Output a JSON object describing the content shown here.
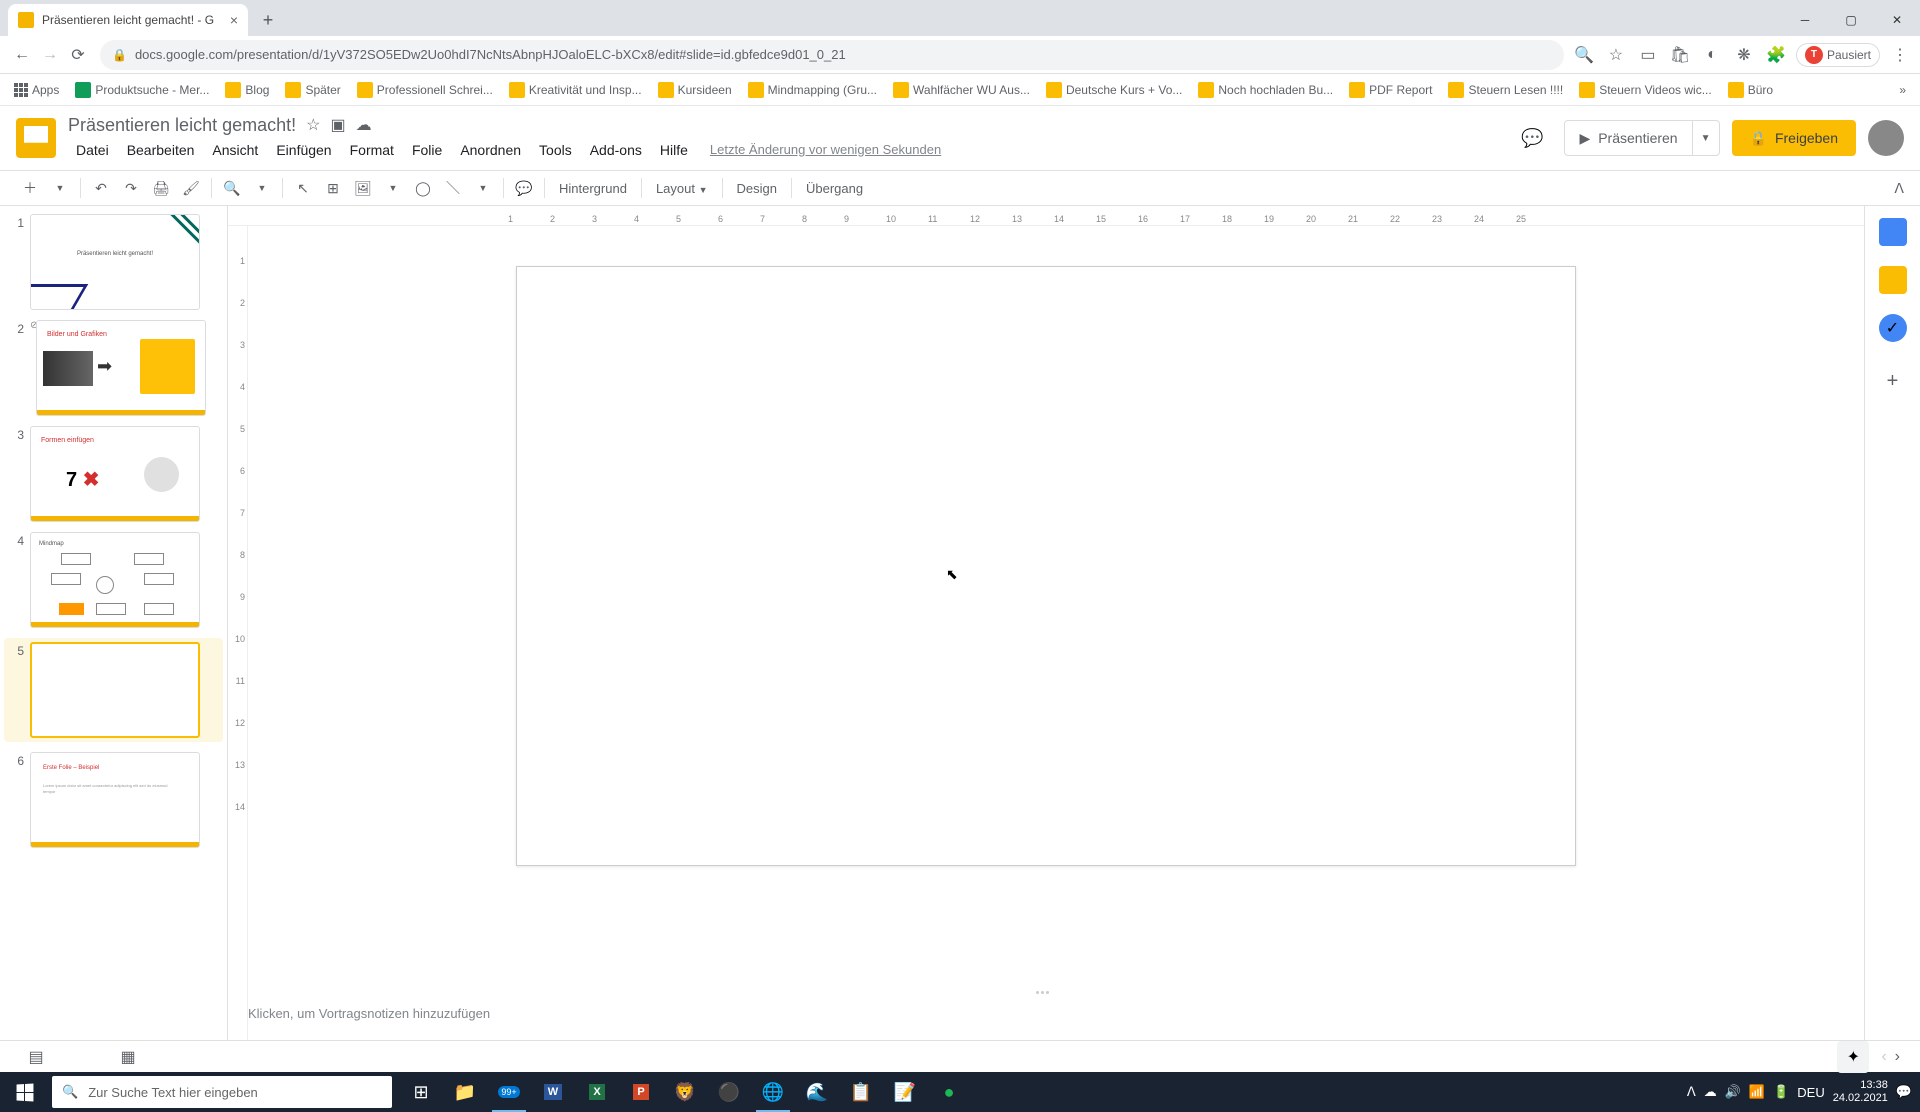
{
  "browser": {
    "tab_title": "Präsentieren leicht gemacht! - G",
    "url": "docs.google.com/presentation/d/1yV372SO5EDw2Uo0hdI7NcNtsAbnpHJOaloELC-bXCx8/edit#slide=id.gbfedce9d01_0_21",
    "pause_label": "Pausiert",
    "pause_letter": "T"
  },
  "bookmarks": {
    "apps": "Apps",
    "items": [
      "Produktsuche - Mer...",
      "Blog",
      "Später",
      "Professionell Schrei...",
      "Kreativität und Insp...",
      "Kursideen",
      "Mindmapping  (Gru...",
      "Wahlfächer WU Aus...",
      "Deutsche Kurs + Vo...",
      "Noch hochladen Bu...",
      "PDF Report",
      "Steuern Lesen !!!!",
      "Steuern Videos wic...",
      "Büro"
    ]
  },
  "doc": {
    "title": "Präsentieren leicht gemacht!",
    "menus": [
      "Datei",
      "Bearbeiten",
      "Ansicht",
      "Einfügen",
      "Format",
      "Folie",
      "Anordnen",
      "Tools",
      "Add-ons",
      "Hilfe"
    ],
    "last_edit": "Letzte Änderung vor wenigen Sekunden",
    "present": "Präsentieren",
    "share": "Freigeben"
  },
  "toolbar": {
    "hintergrund": "Hintergrund",
    "layout": "Layout",
    "design": "Design",
    "uebergang": "Übergang"
  },
  "ruler_h": [
    "1",
    "2",
    "3",
    "4",
    "5",
    "6",
    "7",
    "8",
    "9",
    "10",
    "11",
    "12",
    "13",
    "14",
    "15",
    "16",
    "17",
    "18",
    "19",
    "20",
    "21",
    "22",
    "23",
    "24",
    "25"
  ],
  "ruler_v": [
    "1",
    "2",
    "3",
    "4",
    "5",
    "6",
    "7",
    "8",
    "9",
    "10",
    "11",
    "12",
    "13",
    "14"
  ],
  "thumbnails": [
    {
      "num": "1",
      "label": "Präsentieren leicht gemacht!"
    },
    {
      "num": "2",
      "label": "Bilder und Grafiken"
    },
    {
      "num": "3",
      "label": "Formen einfügen",
      "seven": "7"
    },
    {
      "num": "4",
      "label": "Mindmap"
    },
    {
      "num": "5",
      "label": ""
    },
    {
      "num": "6",
      "label": "Erste Folie – Beispiel"
    }
  ],
  "notes_placeholder": "Klicken, um Vortragsnotizen hinzuzufügen",
  "taskbar": {
    "search_placeholder": "Zur Suche Text hier eingeben",
    "badge": "99+",
    "lang": "DEU",
    "time": "13:38",
    "date": "24.02.2021"
  }
}
